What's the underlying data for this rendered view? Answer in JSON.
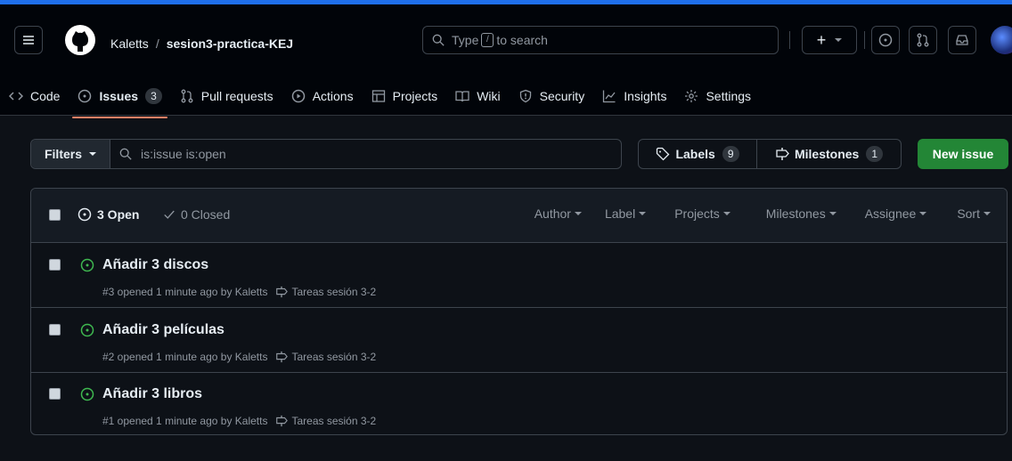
{
  "header": {
    "owner": "Kaletts",
    "separator": "/",
    "repo": "sesion3-practica-KEJ",
    "search_prefix": "Type",
    "search_key": "/",
    "search_suffix": "to search",
    "create_label": "+"
  },
  "tabs": [
    {
      "label": "Code",
      "icon": "code-icon"
    },
    {
      "label": "Issues",
      "icon": "issue-opened-icon",
      "count": "3"
    },
    {
      "label": "Pull requests",
      "icon": "git-pull-request-icon"
    },
    {
      "label": "Actions",
      "icon": "play-icon"
    },
    {
      "label": "Projects",
      "icon": "table-icon"
    },
    {
      "label": "Wiki",
      "icon": "book-icon"
    },
    {
      "label": "Security",
      "icon": "shield-icon"
    },
    {
      "label": "Insights",
      "icon": "graph-icon"
    },
    {
      "label": "Settings",
      "icon": "gear-icon"
    }
  ],
  "toolbar": {
    "filters_label": "Filters",
    "filter_value": "is:issue is:open",
    "labels_label": "Labels",
    "labels_count": "9",
    "milestones_label": "Milestones",
    "milestones_count": "1",
    "new_issue_label": "New issue"
  },
  "list_header": {
    "open_label": "3 Open",
    "closed_label": "0 Closed",
    "sorters": [
      "Author",
      "Label",
      "Projects",
      "Milestones",
      "Assignee",
      "Sort"
    ]
  },
  "issues": [
    {
      "title": "Añadir 3 discos",
      "meta": "#3 opened 1 minute ago by Kaletts",
      "milestone": "Tareas sesión 3-2"
    },
    {
      "title": "Añadir 3 películas",
      "meta": "#2 opened 1 minute ago by Kaletts",
      "milestone": "Tareas sesión 3-2"
    },
    {
      "title": "Añadir 3 libros",
      "meta": "#1 opened 1 minute ago by Kaletts",
      "milestone": "Tareas sesión 3-2"
    }
  ],
  "colors": {
    "background": "#0d1117",
    "header_bg": "#010409",
    "accent_blue": "#1f6feb",
    "tab_underline": "#f78166",
    "open_green": "#3fb950",
    "button_green": "#238636"
  }
}
